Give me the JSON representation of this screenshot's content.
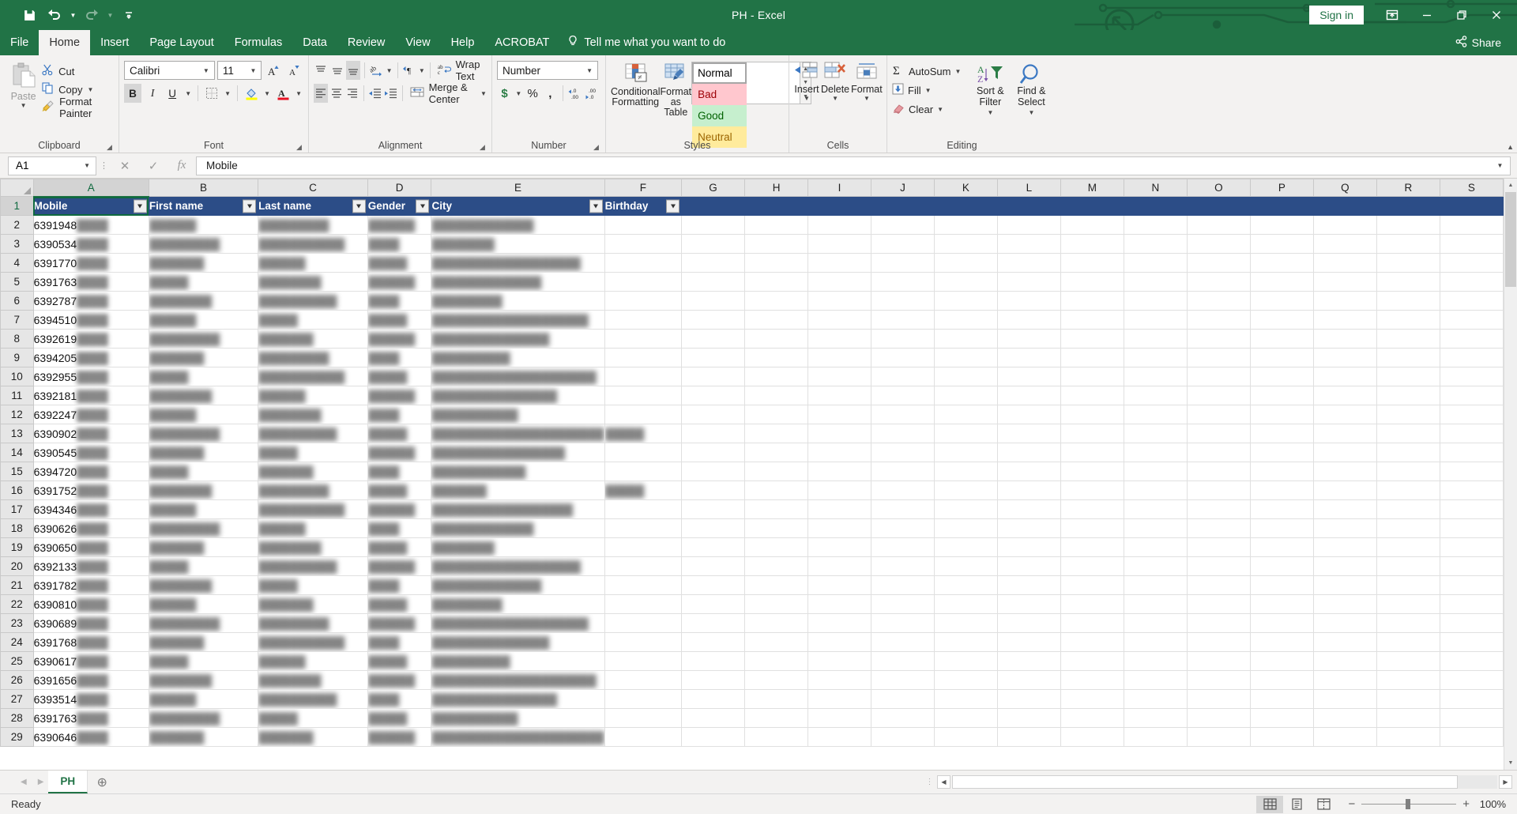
{
  "titlebar": {
    "save_tip": "Save",
    "undo_tip": "Undo",
    "redo_tip": "Redo",
    "customize_tip": "Customize Quick Access Toolbar",
    "title": "PH  -  Excel",
    "signin": "Sign in",
    "ribbon_display_tip": "Ribbon Display Options",
    "minimize_tip": "Minimize",
    "restore_tip": "Restore Down",
    "close_tip": "Close"
  },
  "tabs": [
    {
      "label": "File",
      "active": false
    },
    {
      "label": "Home",
      "active": true
    },
    {
      "label": "Insert",
      "active": false
    },
    {
      "label": "Page Layout",
      "active": false
    },
    {
      "label": "Formulas",
      "active": false
    },
    {
      "label": "Data",
      "active": false
    },
    {
      "label": "Review",
      "active": false
    },
    {
      "label": "View",
      "active": false
    },
    {
      "label": "Help",
      "active": false
    },
    {
      "label": "ACROBAT",
      "active": false
    }
  ],
  "tellme": "Tell me what you want to do",
  "share": "Share",
  "ribbon": {
    "clipboard": {
      "label": "Clipboard",
      "paste": "Paste",
      "cut": "Cut",
      "copy": "Copy",
      "format_painter": "Format Painter"
    },
    "font": {
      "label": "Font",
      "family": "Calibri",
      "size": "11",
      "grow": "A",
      "shrink": "A",
      "bold": "B",
      "italic": "I",
      "underline": "U"
    },
    "alignment": {
      "label": "Alignment",
      "wrap_text": "Wrap Text",
      "merge_center": "Merge & Center"
    },
    "number": {
      "label": "Number",
      "format": "Number",
      "currency": "$",
      "percent": "%",
      "comma": ","
    },
    "styles": {
      "label": "Styles",
      "conditional_formatting": "Conditional Formatting",
      "format_as_table": "Format as Table",
      "cell_styles": [
        {
          "name": "Normal",
          "bg": "#ffffff",
          "fg": "#000000"
        },
        {
          "name": "Bad",
          "bg": "#ffc7ce",
          "fg": "#9c0006"
        },
        {
          "name": "Good",
          "bg": "#c6efce",
          "fg": "#006100"
        },
        {
          "name": "Neutral",
          "bg": "#ffeb9c",
          "fg": "#9c6500"
        }
      ]
    },
    "cells": {
      "label": "Cells",
      "insert": "Insert",
      "delete": "Delete",
      "format": "Format"
    },
    "editing": {
      "label": "Editing",
      "autosum": "AutoSum",
      "fill": "Fill",
      "clear": "Clear",
      "sort_filter": "Sort & Filter",
      "find_select": "Find & Select"
    }
  },
  "formula_bar": {
    "name_box": "A1",
    "cancel": "✕",
    "enter": "✓",
    "fx": "fx",
    "content": "Mobile"
  },
  "grid": {
    "column_letters": [
      "A",
      "B",
      "C",
      "D",
      "E",
      "F",
      "G",
      "H",
      "I",
      "J",
      "K",
      "L",
      "M",
      "N",
      "O",
      "P",
      "Q",
      "R",
      "S"
    ],
    "selected_column": "A",
    "selected_row": 1,
    "headers": [
      "Mobile",
      "First name",
      "Last name",
      "Gender",
      "City",
      "Birthday"
    ],
    "rows": [
      {
        "n": 2,
        "mobile": "6391948",
        "birthday": ""
      },
      {
        "n": 3,
        "mobile": "6390534",
        "birthday": ""
      },
      {
        "n": 4,
        "mobile": "6391770",
        "birthday": ""
      },
      {
        "n": 5,
        "mobile": "6391763",
        "birthday": ""
      },
      {
        "n": 6,
        "mobile": "6392787",
        "birthday": ""
      },
      {
        "n": 7,
        "mobile": "6394510",
        "birthday": ""
      },
      {
        "n": 8,
        "mobile": "6392619",
        "birthday": ""
      },
      {
        "n": 9,
        "mobile": "6394205",
        "birthday": ""
      },
      {
        "n": 10,
        "mobile": "6392955",
        "birthday": ""
      },
      {
        "n": 11,
        "mobile": "6392181",
        "birthday": ""
      },
      {
        "n": 12,
        "mobile": "6392247",
        "birthday": ""
      },
      {
        "n": 13,
        "mobile": "6390902",
        "birthday": "redacted"
      },
      {
        "n": 14,
        "mobile": "6390545",
        "birthday": ""
      },
      {
        "n": 15,
        "mobile": "6394720",
        "birthday": ""
      },
      {
        "n": 16,
        "mobile": "6391752",
        "birthday": "redacted"
      },
      {
        "n": 17,
        "mobile": "6394346",
        "birthday": ""
      },
      {
        "n": 18,
        "mobile": "6390626",
        "birthday": ""
      },
      {
        "n": 19,
        "mobile": "6390650",
        "birthday": ""
      },
      {
        "n": 20,
        "mobile": "6392133",
        "birthday": ""
      },
      {
        "n": 21,
        "mobile": "6391782",
        "birthday": ""
      },
      {
        "n": 22,
        "mobile": "6390810",
        "birthday": ""
      },
      {
        "n": 23,
        "mobile": "6390689",
        "birthday": ""
      },
      {
        "n": 24,
        "mobile": "6391768",
        "birthday": ""
      },
      {
        "n": 25,
        "mobile": "6390617",
        "birthday": ""
      },
      {
        "n": 26,
        "mobile": "6391656",
        "birthday": ""
      },
      {
        "n": 27,
        "mobile": "6393514",
        "birthday": ""
      },
      {
        "n": 28,
        "mobile": "6391763",
        "birthday": ""
      },
      {
        "n": 29,
        "mobile": "6390646",
        "birthday": ""
      }
    ]
  },
  "sheetbar": {
    "sheets": [
      {
        "name": "PH",
        "active": true
      }
    ],
    "add_sheet": "+"
  },
  "statusbar": {
    "status": "Ready",
    "view_normal": "Normal",
    "view_page_layout": "Page Layout",
    "view_page_break": "Page Break Preview",
    "zoom_out": "−",
    "zoom_in": "+",
    "zoom": "100%"
  },
  "colors": {
    "excel_green": "#217346",
    "table_header_blue": "#2c4d87",
    "ribbon_bg": "#f3f2f1"
  }
}
